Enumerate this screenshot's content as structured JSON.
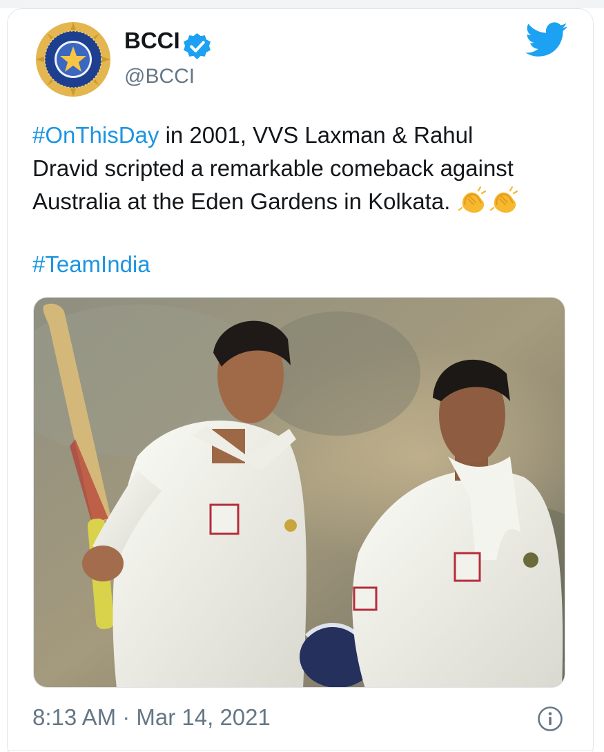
{
  "account": {
    "display_name": "BCCI",
    "handle": "@BCCI",
    "verified": true,
    "avatar_icon": "bcci-crest-logo"
  },
  "brand_icon": "twitter-bird-icon",
  "tweet": {
    "line1_hashtag": "#OnThisDay",
    "line1_text": " in 2001, VVS Laxman & Rahul",
    "line2_text": "Dravid scripted a remarkable comeback against",
    "line3_text": "Australia at the Eden Gardens in Kolkata. ",
    "emoji": [
      "clapping-hands-emoji",
      "clapping-hands-emoji"
    ],
    "hashtag_line": "#TeamIndia"
  },
  "media": {
    "type": "photo",
    "subject": "two-cricketers-in-whites"
  },
  "footer": {
    "timestamp": "8:13 AM · Mar 14, 2021",
    "info_icon": "info-icon"
  },
  "colors": {
    "link": "#1b95e0",
    "verified": "#1da1f2",
    "twitter_bird": "#1da1f2",
    "muted_text": "#657786",
    "primary_text": "#14171a"
  }
}
